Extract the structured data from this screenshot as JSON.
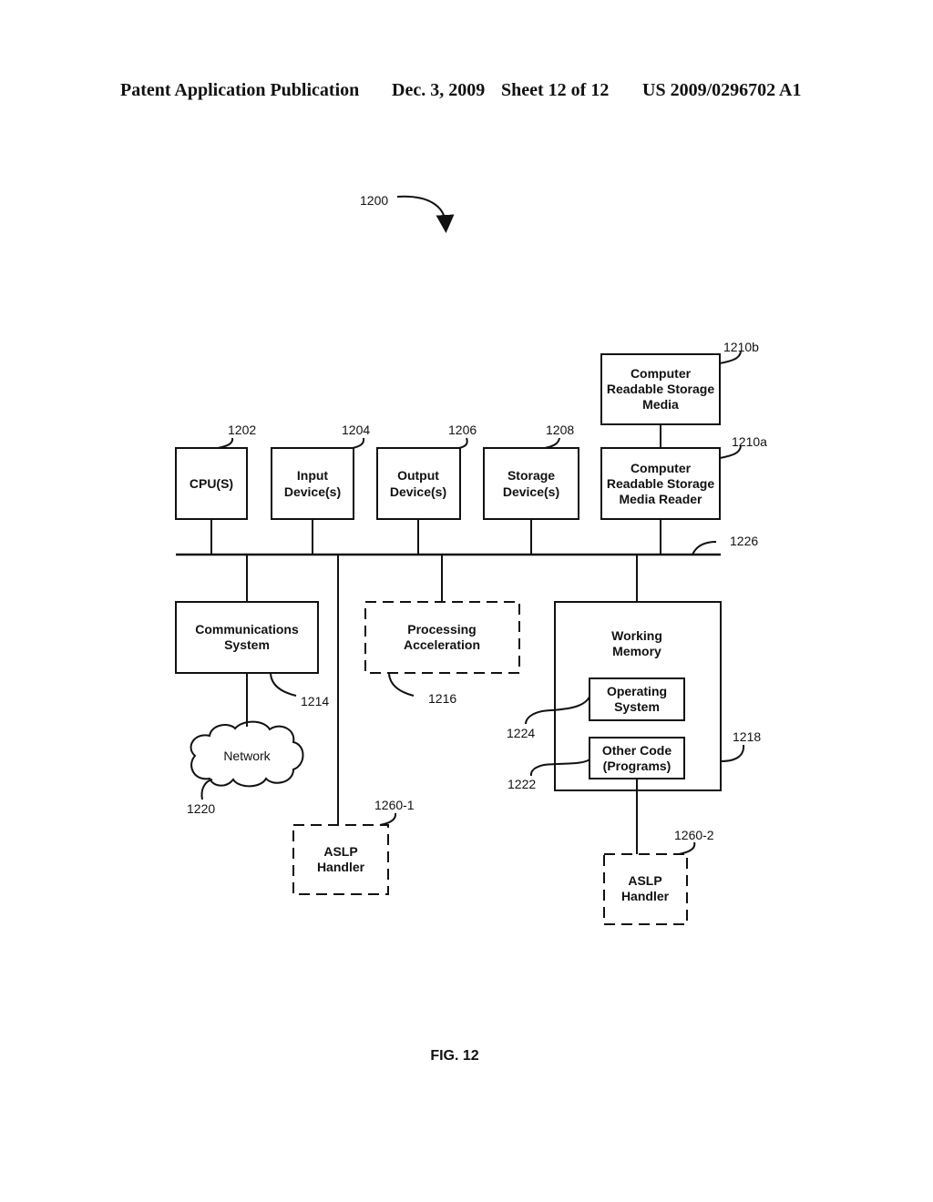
{
  "header": {
    "publication": "Patent Application Publication",
    "date": "Dec. 3, 2009",
    "sheet": "Sheet 12 of 12",
    "number": "US 2009/0296702 A1"
  },
  "diagram": {
    "ref_main": "1200",
    "bus_ref": "1226",
    "figure_label": "FIG. 12",
    "boxes": {
      "cpu": {
        "lines": [
          "CPU(S)"
        ],
        "ref": "1202"
      },
      "input": {
        "lines": [
          "Input",
          "Device(s)"
        ],
        "ref": "1204"
      },
      "output": {
        "lines": [
          "Output",
          "Device(s)"
        ],
        "ref": "1206"
      },
      "storage": {
        "lines": [
          "Storage",
          "Device(s)"
        ],
        "ref": "1208"
      },
      "crs_reader": {
        "lines": [
          "Computer",
          "Readable Storage",
          "Media Reader"
        ],
        "ref": "1210a"
      },
      "crs_media": {
        "lines": [
          "Computer",
          "Readable Storage",
          "Media"
        ],
        "ref": "1210b"
      },
      "comms": {
        "lines": [
          "Communications",
          "System"
        ],
        "ref": "1214"
      },
      "accel": {
        "lines": [
          "Processing",
          "Acceleration"
        ],
        "ref": "1216"
      },
      "memory": {
        "lines": [
          "Working",
          "Memory"
        ],
        "ref": "1218"
      },
      "os": {
        "lines": [
          "Operating",
          "System"
        ],
        "ref": "1224"
      },
      "other_code": {
        "lines": [
          "Other Code",
          "(Programs)"
        ],
        "ref": "1222"
      },
      "network": {
        "lines": [
          "Network"
        ],
        "ref": "1220"
      },
      "aslp1": {
        "lines": [
          "ASLP",
          "Handler"
        ],
        "ref": "1260-1"
      },
      "aslp2": {
        "lines": [
          "ASLP",
          "Handler"
        ],
        "ref": "1260-2"
      }
    }
  }
}
